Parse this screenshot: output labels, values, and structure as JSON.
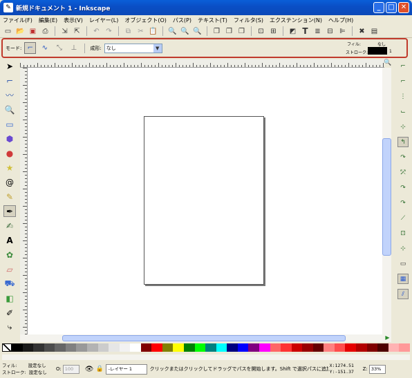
{
  "window": {
    "title": "新規ドキュメント 1 - Inkscape",
    "min": "_",
    "max": "□",
    "close": "✕"
  },
  "menu": [
    {
      "label": "ファイル(F)"
    },
    {
      "label": "編集(E)"
    },
    {
      "label": "表示(V)"
    },
    {
      "label": "レイヤー(L)"
    },
    {
      "label": "オブジェクト(O)"
    },
    {
      "label": "パス(P)"
    },
    {
      "label": "テキスト(T)"
    },
    {
      "label": "フィルタ(S)"
    },
    {
      "label": "エクステンション(N)"
    },
    {
      "label": "ヘルプ(H)"
    }
  ],
  "toolbar": {
    "icons": [
      "new-icon",
      "open-icon",
      "save-icon",
      "print-icon",
      "import-icon",
      "export-icon",
      "undo-icon",
      "redo-icon",
      "copy-icon",
      "cut-icon",
      "paste-icon",
      "zoom-selection-icon",
      "zoom-drawing-icon",
      "zoom-page-icon",
      "duplicate-icon",
      "clone-icon",
      "unlink-clone-icon",
      "group-icon",
      "ungroup-icon",
      "fill-stroke-icon",
      "text-icon",
      "layers-icon",
      "xml-editor-icon",
      "align-icon",
      "preferences-icon",
      "document-properties-icon"
    ]
  },
  "controls": {
    "mode_label": "モード:",
    "shape_label": "成形:",
    "shape_value": "なし",
    "fill_label": "フィル:",
    "fill_value": "なし",
    "stroke_label": "ストローク:",
    "stroke_width": "1",
    "stroke_color": "#000000"
  },
  "status": {
    "fill_label": "フィル:",
    "fill_value": "設定なし",
    "stroke_label": "ストローク:",
    "stroke_value": "設定なし",
    "opacity_label": "O:",
    "opacity_value": "100",
    "layer": "-レイヤー 1",
    "message": "クリックまたはクリックしてドラッグでパスを開始します。Shift で選択パスに追加",
    "x": "X:1274.51",
    "y": "Y:-151.37",
    "zoom_label": "Z:",
    "zoom": "33%"
  },
  "colors": {
    "accent": "#c0392b",
    "titlebar": "#0a55d0"
  },
  "palette": [
    "#000000",
    "#1a1a1a",
    "#333333",
    "#4d4d4d",
    "#666666",
    "#808080",
    "#999999",
    "#b3b3b3",
    "#cccccc",
    "#e6e6e6",
    "#f2f2f2",
    "#ffffff",
    "#800000",
    "#ff0000",
    "#808000",
    "#ffff00",
    "#008000",
    "#00ff00",
    "#008080",
    "#00ffff",
    "#000080",
    "#0000ff",
    "#800080",
    "#ff00ff",
    "#ff6666",
    "#ff3333",
    "#cc0000",
    "#990000",
    "#660000",
    "#ff8080",
    "#ff4d4d",
    "#e60000",
    "#b30000",
    "#800000",
    "#4d0000",
    "#ffb3b3",
    "#ff9999"
  ]
}
